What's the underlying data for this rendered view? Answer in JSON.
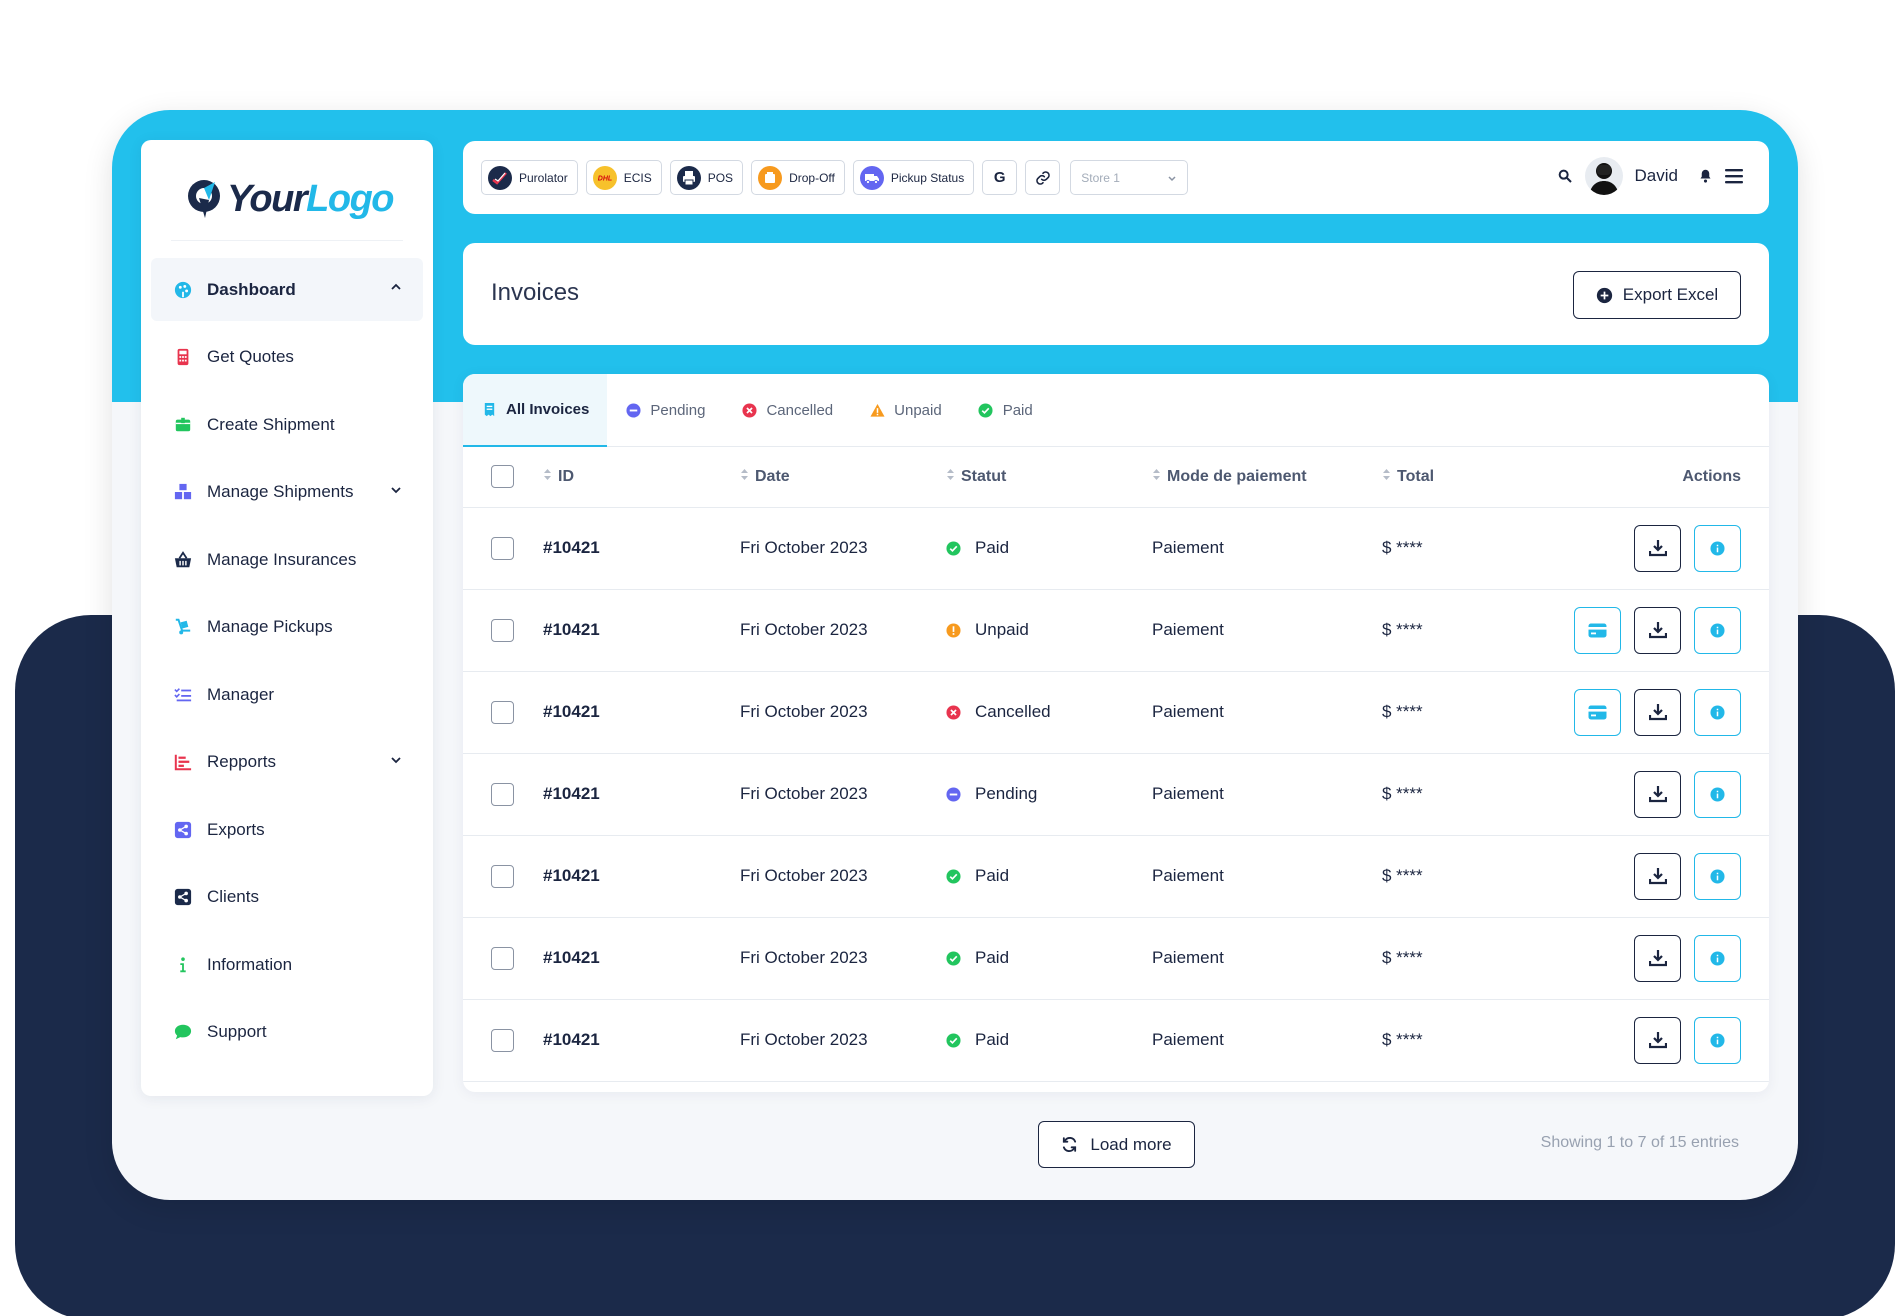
{
  "brand": {
    "logo_part1": "Your",
    "logo_part2": "Logo"
  },
  "sidebar": {
    "items": [
      {
        "label": "Dashboard",
        "icon": "palette-icon",
        "color": "#22b8e8",
        "active": true,
        "chevron": "up"
      },
      {
        "label": "Get Quotes",
        "icon": "calculator-icon",
        "color": "#e8344e"
      },
      {
        "label": "Create Shipment",
        "icon": "box-icon",
        "color": "#22c55e"
      },
      {
        "label": "Manage Shipments",
        "icon": "boxes-icon",
        "color": "#6366f1",
        "chevron": "down"
      },
      {
        "label": "Manage Insurances",
        "icon": "basket-icon",
        "color": "#1b2a4a"
      },
      {
        "label": "Manage Pickups",
        "icon": "dolly-icon",
        "color": "#22b8e8"
      },
      {
        "label": "Manager",
        "icon": "list-check-icon",
        "color": "#6366f1"
      },
      {
        "label": "Repports",
        "icon": "bar-chart-icon",
        "color": "#e8344e",
        "chevron": "down"
      },
      {
        "label": "Exports",
        "icon": "share-square-icon",
        "color": "#6366f1"
      },
      {
        "label": "Clients",
        "icon": "share-square-icon",
        "color": "#1b2a4a"
      },
      {
        "label": "Information",
        "icon": "info-icon",
        "color": "#22c55e"
      },
      {
        "label": "Support",
        "icon": "chat-icon",
        "color": "#22c55e"
      }
    ]
  },
  "topbar": {
    "chips": [
      {
        "label": "Purolator",
        "icon": "purolator-icon",
        "color": "#1b2a4a"
      },
      {
        "label": "ECIS",
        "icon": "dhl-icon",
        "color": "#f7c12b"
      },
      {
        "label": "POS",
        "icon": "printer-icon",
        "color": "#1b2a4a"
      },
      {
        "label": "Drop-Off",
        "icon": "store-icon",
        "color": "#f79a1e"
      },
      {
        "label": "Pickup Status",
        "icon": "truck-icon",
        "color": "#6366f1"
      }
    ],
    "store": {
      "value": "Store 1"
    },
    "user": {
      "name": "David"
    }
  },
  "page": {
    "title": "Invoices",
    "export_label": "Export Excel"
  },
  "tabs": [
    {
      "label": "All Invoices",
      "icon": "invoice-icon",
      "color": "#22b8e8",
      "active": true
    },
    {
      "label": "Pending",
      "icon": "minus-circle-icon",
      "color": "#6366f1"
    },
    {
      "label": "Cancelled",
      "icon": "x-circle-icon",
      "color": "#e8344e"
    },
    {
      "label": "Unpaid",
      "icon": "warning-icon",
      "color": "#f79a1e"
    },
    {
      "label": "Paid",
      "icon": "check-circle-icon",
      "color": "#22c55e"
    }
  ],
  "table": {
    "columns": {
      "id": "ID",
      "date": "Date",
      "status": "Statut",
      "payment": "Mode de paiement",
      "total": "Total",
      "actions": "Actions"
    },
    "rows": [
      {
        "id": "#10421",
        "date": "Fri October 2023",
        "status": "Paid",
        "payment": "Paiement",
        "total": "$ ****"
      },
      {
        "id": "#10421",
        "date": "Fri October 2023",
        "status": "Unpaid",
        "payment": "Paiement",
        "total": "$ ****"
      },
      {
        "id": "#10421",
        "date": "Fri October 2023",
        "status": "Cancelled",
        "payment": "Paiement",
        "total": "$ ****"
      },
      {
        "id": "#10421",
        "date": "Fri October 2023",
        "status": "Pending",
        "payment": "Paiement",
        "total": "$ ****"
      },
      {
        "id": "#10421",
        "date": "Fri October 2023",
        "status": "Paid",
        "payment": "Paiement",
        "total": "$ ****"
      },
      {
        "id": "#10421",
        "date": "Fri October 2023",
        "status": "Paid",
        "payment": "Paiement",
        "total": "$ ****"
      },
      {
        "id": "#10421",
        "date": "Fri October 2023",
        "status": "Paid",
        "payment": "Paiement",
        "total": "$ ****"
      }
    ]
  },
  "status_colors": {
    "Paid": "#22c55e",
    "Unpaid": "#f79a1e",
    "Cancelled": "#e8344e",
    "Pending": "#6366f1"
  },
  "footer": {
    "load_more": "Load more",
    "showing": "Showing 1 to 7 of 15 entries"
  }
}
